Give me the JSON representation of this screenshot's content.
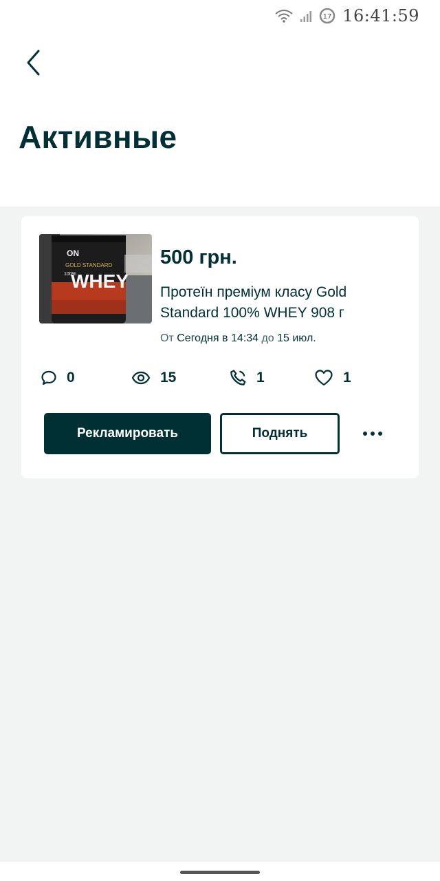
{
  "status_bar": {
    "time": "16:41:59",
    "notification_badge": "17"
  },
  "header": {
    "title": "Активные"
  },
  "ad": {
    "price": "500 грн.",
    "title": "Протеїн преміум класу Gold Standard 100% WHEY 908 г",
    "date_from_prefix": "От",
    "date_from": "Сегодня в 14:34",
    "date_to_prefix": "до",
    "date_to": "15 июл.",
    "image_brand": "ON",
    "image_product_line": "GOLD STANDARD",
    "image_product": "WHEY",
    "image_percent": "100%",
    "stats": {
      "messages": "0",
      "views": "15",
      "calls": "1",
      "favorites": "1"
    },
    "actions": {
      "promote_label": "Рекламировать",
      "raise_label": "Поднять"
    }
  },
  "colors": {
    "primary": "#002f34",
    "background": "#f2f4f4",
    "card": "#ffffff"
  }
}
